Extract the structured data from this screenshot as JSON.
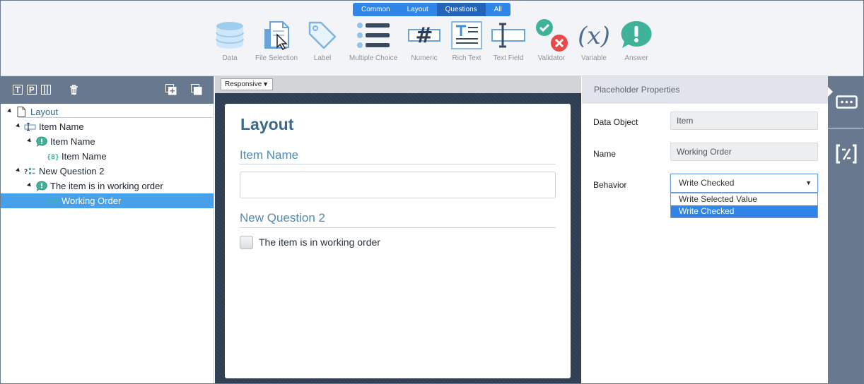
{
  "toolbar": {
    "tabs": [
      {
        "label": "Common",
        "active": false
      },
      {
        "label": "Layout",
        "active": false
      },
      {
        "label": "Questions",
        "active": true
      },
      {
        "label": "All",
        "active": false
      }
    ],
    "tools": [
      {
        "label": "Data",
        "icon": "database-icon"
      },
      {
        "label": "File Selection",
        "icon": "file-selection-icon"
      },
      {
        "label": "Label",
        "icon": "tag-icon"
      },
      {
        "label": "Multiple Choice",
        "icon": "list-icon"
      },
      {
        "label": "Numeric",
        "icon": "hash-icon"
      },
      {
        "label": "Rich Text",
        "icon": "rich-text-icon"
      },
      {
        "label": "Text Field",
        "icon": "text-field-icon"
      },
      {
        "label": "Validator",
        "icon": "validator-icon"
      },
      {
        "label": "Variable",
        "icon": "variable-icon"
      },
      {
        "label": "Answer",
        "icon": "answer-icon"
      }
    ],
    "colors": {
      "tab": "#2f86e8",
      "tab_active": "#2364b8"
    }
  },
  "tree": {
    "icons": [
      "text-mode-icon",
      "text-mode-p-icon",
      "columns-icon",
      "delete-icon",
      "add-item-icon",
      "copy-icon"
    ],
    "nodes": [
      {
        "label": "Layout",
        "icon": "page-icon",
        "expanded": true
      },
      {
        "label": "Item Name",
        "icon": "input-field-icon",
        "expanded": true
      },
      {
        "label": "Item Name",
        "icon": "speech-bubble-icon",
        "expanded": true
      },
      {
        "label": "Item Name",
        "icon": "placeholder-icon"
      },
      {
        "label": "New Question 2",
        "icon": "question-icon",
        "expanded": true
      },
      {
        "label": "The item is in working order",
        "icon": "speech-bubble-icon",
        "expanded": true
      },
      {
        "label": "Working Order",
        "icon": "placeholder-icon",
        "selected": true
      }
    ]
  },
  "canvas": {
    "responsive": "Responsive",
    "form_title": "Layout",
    "q1_title": "Item Name",
    "q1_value": "",
    "q2_title": "New Question 2",
    "q2_checkbox_label": "The item is in working order",
    "q2_checked": false
  },
  "properties": {
    "header": "Placeholder Properties",
    "data_object_label": "Data Object",
    "data_object_value": "Item",
    "name_label": "Name",
    "name_value": "Working Order",
    "behavior_label": "Behavior",
    "behavior_value": "Write Checked",
    "behavior_options": [
      {
        "label": "Write Selected Value",
        "selected": false
      },
      {
        "label": "Write Checked",
        "selected": true
      }
    ]
  },
  "right_rail": {
    "icons": [
      "input-placeholder-icon",
      "variable-brackets-icon"
    ]
  }
}
